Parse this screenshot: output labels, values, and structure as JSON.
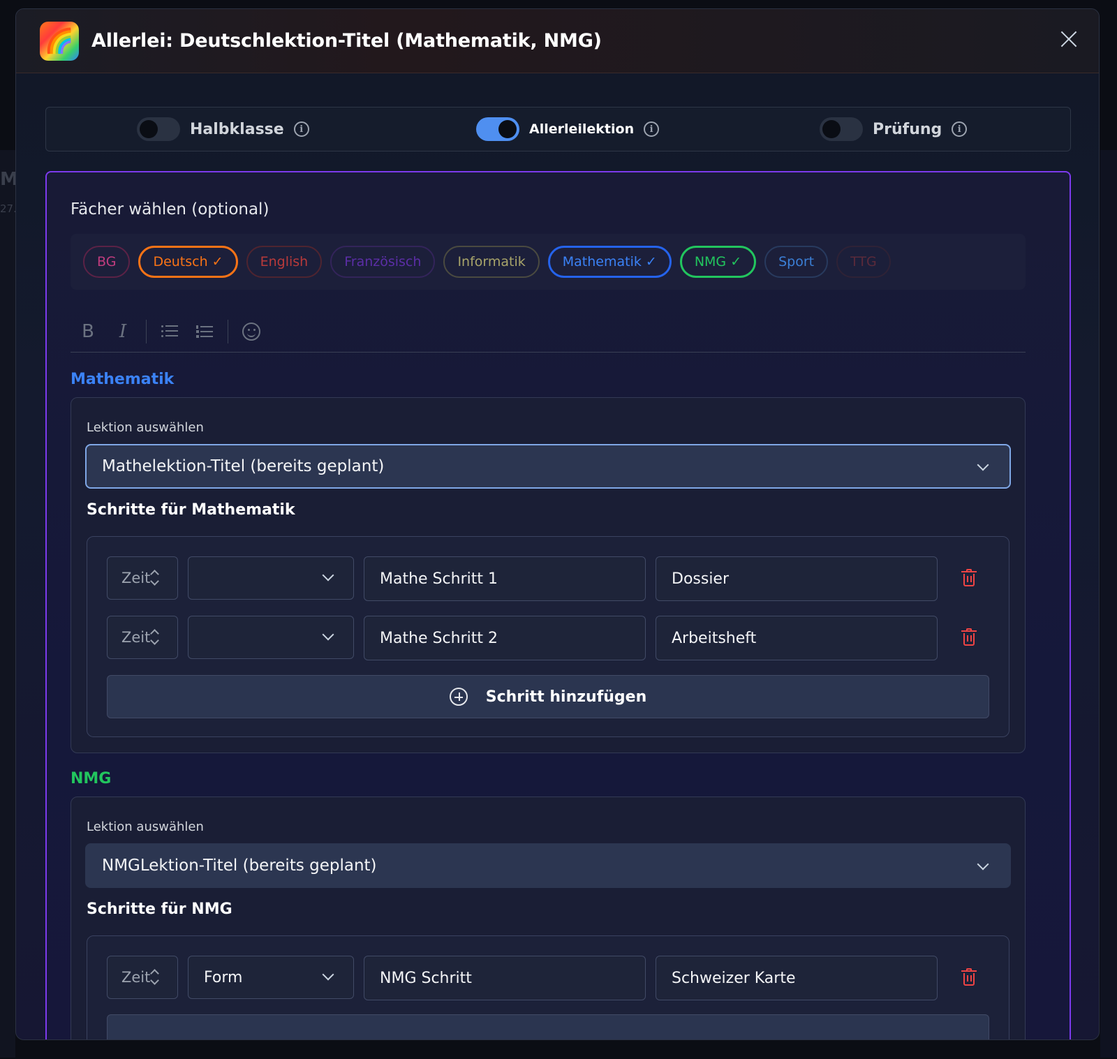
{
  "modal": {
    "title": "Allerlei: Deutschlektion-Titel (Mathematik, NMG)",
    "logo_icon": "rainbow-icon"
  },
  "toggles": [
    {
      "label": "Halbklasse",
      "on": false
    },
    {
      "label": "Allerleilektion",
      "on": true
    },
    {
      "label": "Prüfung",
      "on": false
    }
  ],
  "subjects_section": {
    "label": "Fächer wählen (optional)",
    "pills": [
      {
        "label": "BG",
        "selected": false,
        "color": "#ec4899"
      },
      {
        "label": "Deutsch ✓",
        "selected": true,
        "color": "#f97316"
      },
      {
        "label": "English",
        "selected": false,
        "color": "#ef4444"
      },
      {
        "label": "Französisch",
        "selected": false,
        "color": "#7c3aed"
      },
      {
        "label": "Informatik",
        "selected": false,
        "color": "#a3a35a"
      },
      {
        "label": "Mathematik ✓",
        "selected": true,
        "color": "#3b82f6"
      },
      {
        "label": "NMG ✓",
        "selected": true,
        "color": "#22c55e"
      },
      {
        "label": "Sport",
        "selected": false,
        "color": "#3b82f6"
      },
      {
        "label": "TTG",
        "selected": false,
        "color": "#f43f5e"
      }
    ]
  },
  "editor_toolbar": {
    "bold": "B",
    "italic": "I"
  },
  "mathematik": {
    "title": "Mathematik",
    "color": "#3b82f6",
    "lesson_label": "Lektion auswählen",
    "lesson_value": "Mathelektion-Titel (bereits geplant)",
    "steps_title": "Schritte für Mathematik",
    "steps": [
      {
        "time": "Zeit",
        "form": "",
        "step": "Mathe Schritt 1",
        "material": "Dossier"
      },
      {
        "time": "Zeit",
        "form": "",
        "step": "Mathe Schritt 2",
        "material": "Arbeitsheft"
      }
    ],
    "add_step_label": "Schritt hinzufügen"
  },
  "nmg": {
    "title": "NMG",
    "color": "#22c55e",
    "lesson_label": "Lektion auswählen",
    "lesson_value": "NMGLektion-Titel (bereits geplant)",
    "steps_title": "Schritte für NMG",
    "steps": [
      {
        "time": "Zeit",
        "form": "Form",
        "step": "NMG Schritt",
        "material": "Schweizer Karte"
      }
    ]
  },
  "background": {
    "letter": "M",
    "number": "27."
  }
}
